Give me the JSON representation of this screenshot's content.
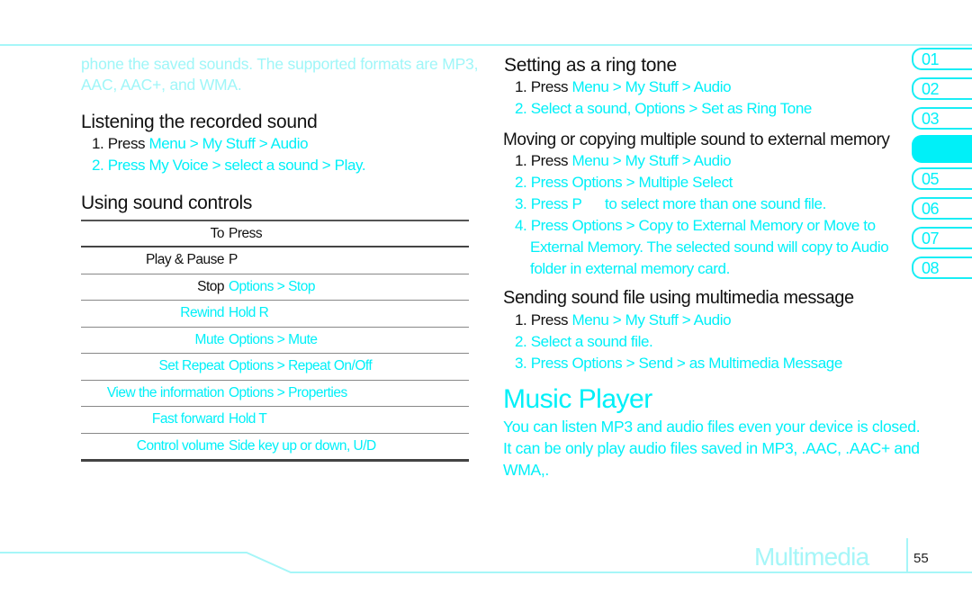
{
  "intro": {
    "line1": "phone the saved sounds. The supported formats are MP3,",
    "line2": "AAC, AAC+, and WMA."
  },
  "listening": {
    "heading": "Listening the recorded sound",
    "steps": [
      {
        "num": "1. Press",
        "path": "Menu > My Stuff > Audio"
      },
      {
        "num": "2. Press",
        "path": "My Voice > select a sound > Play."
      }
    ]
  },
  "controls": {
    "heading": "Using sound controls",
    "columns": [
      "To",
      "Press"
    ],
    "rows": [
      {
        "to": "Play & Pause",
        "press": "P"
      },
      {
        "to": "Stop",
        "press": "Options > Stop"
      },
      {
        "to": "Rewind",
        "press": "Hold R"
      },
      {
        "to": "Mute",
        "press": "Options > Mute"
      },
      {
        "to": "Set Repeat",
        "press": "Options > Repeat On/Off"
      },
      {
        "to": "View the information",
        "press": "Options > Properties"
      },
      {
        "to": "Fast forward",
        "press": "Hold T"
      },
      {
        "to": "Control volume",
        "press": "Side key up or down, U/D"
      }
    ]
  },
  "ringtone": {
    "heading": "Setting as a ring tone",
    "steps": [
      {
        "num": "1. Press",
        "path": "Menu > My Stuff > Audio"
      },
      {
        "num": "2. Select a sound,",
        "path": "Options > Set as Ring Tone"
      }
    ]
  },
  "moving": {
    "heading": "Moving or copying multiple sound to external memory",
    "steps": [
      {
        "num": "1. Press",
        "path": "Menu > My Stuff > Audio"
      },
      {
        "num": "2. Press",
        "path": "Options > Multiple Select"
      },
      {
        "num": "3. Press",
        "path": "P      to select more than one sound file."
      },
      {
        "num": "4. Press",
        "path": "Options > Copy to External Memory or Move to"
      },
      {
        "num": "",
        "path": "External Memory. The selected sound will copy to Audio"
      },
      {
        "num": "",
        "path": "folder in external memory card."
      }
    ]
  },
  "sending": {
    "heading": "Sending sound file using multimedia message",
    "steps": [
      {
        "num": "1. Press",
        "path": "Menu > My Stuff > Audio"
      },
      {
        "num": "2. Select a sound file.",
        "path": ""
      },
      {
        "num": "3. Press",
        "path": "Options > Send > as Multimedia Message"
      }
    ]
  },
  "music_player": {
    "title": "Music Player",
    "line1": "You can listen MP3 and audio files even your device is closed.",
    "line2": "It can be only play audio files saved in MP3, .AAC, .AAC+ and",
    "line3": "WMA,."
  },
  "chapter_tabs": [
    {
      "label": "01",
      "active": false
    },
    {
      "label": "02",
      "active": false
    },
    {
      "label": "03",
      "active": false
    },
    {
      "label": "",
      "active": true
    },
    {
      "label": "05",
      "active": false
    },
    {
      "label": "06",
      "active": false
    },
    {
      "label": "07",
      "active": false
    },
    {
      "label": "08",
      "active": false
    }
  ],
  "footer": {
    "section": "Multimedia",
    "page": "55"
  },
  "colors": {
    "accent": "#00f0f8",
    "pale_accent": "#a6f6f8",
    "text": "#111111"
  }
}
